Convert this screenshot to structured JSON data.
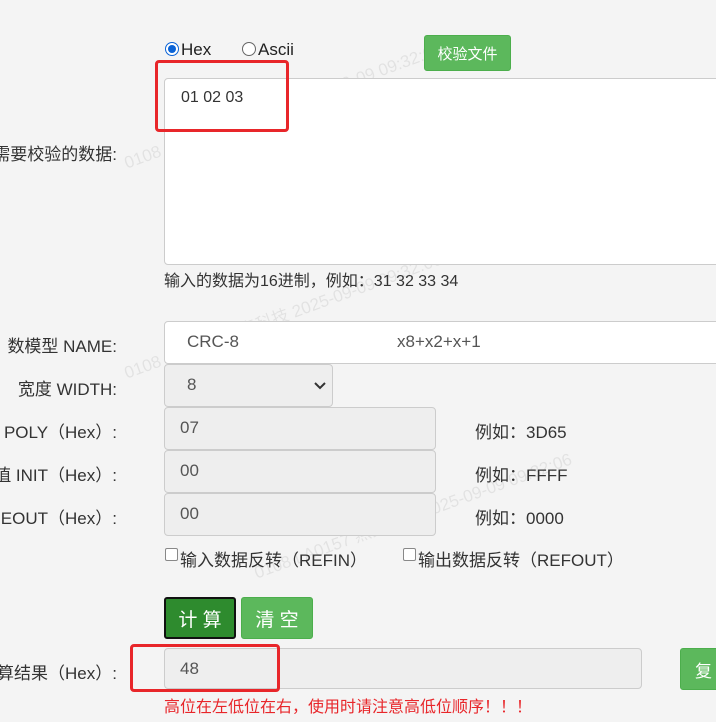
{
  "format": {
    "hex_label": "Hex",
    "ascii_label": "Ascii",
    "selected": "Hex",
    "verify_file_button": "校验文件"
  },
  "data_input": {
    "label": "需要校验的数据:",
    "value": "01 02 03",
    "hint": "输入的数据为16进制，例如：31 32 33 34"
  },
  "model": {
    "label": "数模型 NAME:",
    "value": "CRC-8",
    "poly_expr": "x8+x2+x+1"
  },
  "width": {
    "label": "宽度 WIDTH:",
    "value": "8"
  },
  "poly": {
    "label": "POLY（Hex）:",
    "value": "07",
    "example": "例如：3D65"
  },
  "init": {
    "label": "值 INIT（Hex）:",
    "value": "00",
    "example": "例如：FFFF"
  },
  "xorout": {
    "label": "REOUT（Hex）:",
    "value": "00",
    "example": "例如：0000"
  },
  "refin": {
    "label": "输入数据反转（REFIN）",
    "checked": false
  },
  "refout": {
    "label": "输出数据反转（REFOUT）",
    "checked": false
  },
  "buttons": {
    "calculate": "计 算",
    "clear": "清 空",
    "copy": "复"
  },
  "result": {
    "label": "算结果（Hex）:",
    "value": "48",
    "warning": "高位在左低位在右，使用时请注意高低位顺序！！！"
  },
  "watermark": {
    "text1": "0108  LA0157  燕麦科技  2025-09-09  09:32:06",
    "text2": "0108  LA0157  燕麦科技  2025-09-09  09:32:06"
  },
  "colors": {
    "accent_green": "#5cb85c",
    "dark_green": "#2e8b2e",
    "warning_red": "#e8262a",
    "radio_blue": "#0b63d6"
  }
}
